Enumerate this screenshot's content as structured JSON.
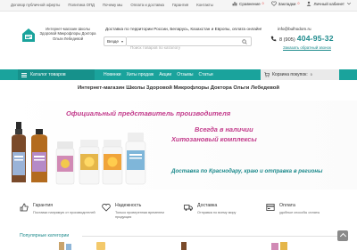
{
  "topbar": {
    "links": [
      "Договор публичной оферты",
      "Политика ОПД",
      "Почему мы",
      "Оплата и доставка",
      "Гарантия",
      "Контакты"
    ],
    "compare_label": "Сравнение",
    "compare_count": "0",
    "wishlist_label": "Закладки",
    "wishlist_count": "0",
    "account_label": "Личный кабинет"
  },
  "header": {
    "logo_text": "Интернет-магазин Школы Здоровой Микрофлоры Доктора Ольги Лебедевой",
    "delivery_text": "Доставка по территории России, Беларусь, Казахстан и Европы, оплата онлайн!",
    "category_select": "Везде",
    "search_placeholder": "Поиск товаров по каталогу",
    "email": "info@bulhodom.ru",
    "phone_prefix": "8 (905)",
    "phone_number": "404-95-32",
    "callback_label": "Заказать обратный звонок"
  },
  "nav": {
    "catalog_label": "Каталог товаров",
    "links": [
      "Новинки",
      "Хиты продаж",
      "Акции",
      "Отзывы",
      "Статьи"
    ],
    "cart_label": "Корзина покупок:",
    "cart_count": "0"
  },
  "welcome": "Интернет-магазин Школы Здоровой Микрофлоры Доктора Ольги Лебедевой",
  "banner": {
    "official": "Официальный представитель производителя",
    "instock": "Всегда в наличии",
    "complex": "Хитозановый комплексы",
    "delivery": "Доставка по Краснодару, краю и отправка в регионы"
  },
  "features": [
    {
      "icon": "guarantee-icon",
      "title": "Гарантия",
      "desc": "Поставки напрямую от производителей"
    },
    {
      "icon": "heart-icon",
      "title": "Надежность",
      "desc": "Только проверенная временем продукция"
    },
    {
      "icon": "truck-icon",
      "title": "Доставка",
      "desc": "Отправка по всему миру"
    },
    {
      "icon": "payment-icon",
      "title": "Оплата",
      "desc": "удобные способы оплаты"
    }
  ],
  "popular_label": "Популярные категории",
  "colors": {
    "teal": "#1aa39c",
    "teal_dark": "#16918b",
    "magenta": "#c2398a",
    "phone": "#1d8a8c"
  }
}
